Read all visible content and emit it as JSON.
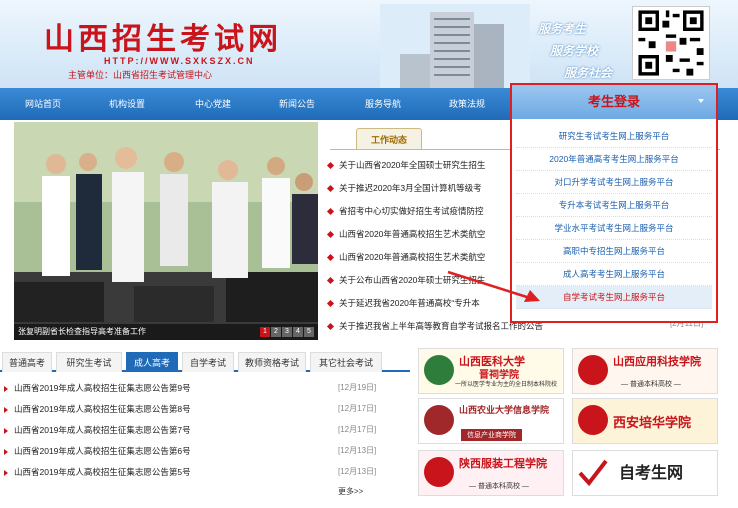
{
  "header": {
    "title": "山西招生考试网",
    "url": "HTTP://WWW.SXKSZX.CN",
    "org": "主管单位：山西省招生考试管理中心",
    "slogans": [
      "服务考生",
      "服务学校",
      "服务社会"
    ]
  },
  "nav": {
    "items": [
      "网站首页",
      "机构设置",
      "中心党建",
      "新闻公告",
      "服务导航",
      "政策法规"
    ]
  },
  "photo": {
    "caption": "张复明副省长检查指导高考准备工作",
    "pages": [
      "1",
      "2",
      "3",
      "4",
      "5"
    ]
  },
  "news": {
    "tab_label": "工作动态",
    "items": [
      "关于山西省2020年全国硕士研究生招生",
      "关于推迟2020年3月全国计算机等级考",
      "省招考中心切实做好招生考试疫情防控",
      "山西省2020年普通高校招生艺术类航空",
      "山西省2020年普通高校招生艺术类航空",
      "关于公布山西省2020年硕士研究生招生",
      "关于延迟我省2020年普通高校“专升本",
      "关于推迟我省上半年高等教育自学考试报名工作的公告"
    ],
    "last_date": "[2月11日]"
  },
  "login": {
    "title": "考生登录",
    "items": [
      "研究生考试考生网上服务平台",
      "2020年普通高考考生网上服务平台",
      "对口升学考试考生网上服务平台",
      "专升本考试考生网上服务平台",
      "学业水平考试考生网上服务平台",
      "高职中专招生网上服务平台",
      "成人高考考生网上服务平台",
      "自学考试考生网上服务平台"
    ]
  },
  "tabs": {
    "items": [
      "普通高考",
      "研究生考试",
      "成人高考",
      "自学考试",
      "教师资格考试",
      "其它社会考试"
    ],
    "active_index": 2
  },
  "list": {
    "items": [
      {
        "title": "山西省2019年成人高校招生征集志愿公告第9号",
        "date": "[12月19日]"
      },
      {
        "title": "山西省2019年成人高校招生征集志愿公告第8号",
        "date": "[12月17日]"
      },
      {
        "title": "山西省2019年成人高校招生征集志愿公告第7号",
        "date": "[12月17日]"
      },
      {
        "title": "山西省2019年成人高校招生征集志愿公告第6号",
        "date": "[12月13日]"
      },
      {
        "title": "山西省2019年成人高校招生征集志愿公告第5号",
        "date": "[12月13日]"
      }
    ],
    "more": "更多>>"
  },
  "ads": [
    {
      "title": "山西医科大学",
      "title2": "晋祠学院",
      "sub": "一所以医学专业为主的全日制本科院校",
      "color": "#c8141a"
    },
    {
      "title": "山西应用科技学院",
      "sub": "— 普通本科高校 —",
      "color": "#c8141a"
    },
    {
      "title": "山西农业大学信息学院",
      "sub": "信息产业商学院",
      "color": "#a0282a"
    },
    {
      "title": "西安培华学院",
      "sub": "",
      "color": "#c8141a"
    },
    {
      "title": "陕西服装工程学院",
      "sub": "— 普通本科高校 —",
      "color": "#c8141a"
    },
    {
      "title": "自考生网",
      "sub": "",
      "color": "#222222"
    }
  ]
}
